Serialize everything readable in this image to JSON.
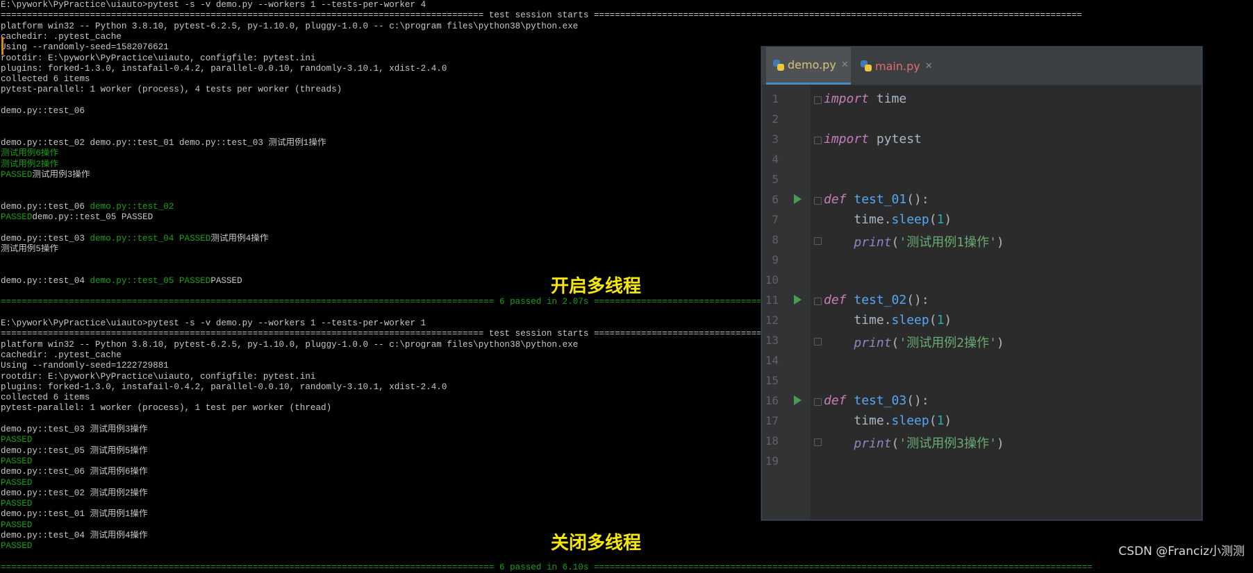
{
  "terminal": {
    "run1": [
      {
        "text": "E:\\pywork\\PyPractice\\uiauto>pytest -s -v demo.py --workers 1 --tests-per-worker 4"
      },
      {
        "text": "============================================================================================ test session starts =============================================================================================",
        "sep": true
      },
      {
        "text": "platform win32 -- Python 3.8.10, pytest-6.2.5, py-1.10.0, pluggy-1.0.0 -- c:\\program files\\python38\\python.exe"
      },
      {
        "text": "cachedir: .pytest_cache"
      },
      {
        "text": "Using --randomly-seed=1582076621"
      },
      {
        "text": "rootdir: E:\\pywork\\PyPractice\\uiauto, configfile: pytest.ini"
      },
      {
        "text": "plugins: forked-1.3.0, instafail-0.4.2, parallel-0.0.10, randomly-3.10.1, xdist-2.4.0"
      },
      {
        "text": "collected 6 items"
      },
      {
        "text": "pytest-parallel: 1 worker (process), 4 tests per worker (threads)"
      },
      {
        "text": ""
      },
      {
        "text": "demo.py::test_06"
      },
      {
        "text": ""
      },
      {
        "text": ""
      },
      {
        "text": "demo.py::test_02 demo.py::test_01 demo.py::test_03 测试用例1操作"
      },
      {
        "text": "测试用例6操作",
        "green": true
      },
      {
        "text": "测试用例2操作",
        "green": true
      },
      {
        "segs": [
          {
            "t": "PASSED",
            "g": true
          },
          {
            "t": "测试用例3操作"
          }
        ]
      },
      {
        "text": ""
      },
      {
        "text": ""
      },
      {
        "segs": [
          {
            "t": "demo.py::test_06 "
          },
          {
            "t": "demo.py::test_02",
            "g": true
          }
        ]
      },
      {
        "segs": [
          {
            "t": "PASSED",
            "g": true
          },
          {
            "t": "demo.py::test_05 PASSED"
          }
        ]
      },
      {
        "text": ""
      },
      {
        "segs": [
          {
            "t": "demo.py::test_03 "
          },
          {
            "t": "demo.py::test_04 PASSED",
            "g": true
          },
          {
            "t": "测试用例4操作"
          }
        ]
      },
      {
        "text": "测试用例5操作"
      },
      {
        "text": ""
      },
      {
        "text": ""
      },
      {
        "segs": [
          {
            "t": "demo.py::test_04 "
          },
          {
            "t": "demo.py::test_05 PASSED",
            "g": true
          },
          {
            "t": "PASSED"
          }
        ]
      },
      {
        "text": ""
      },
      {
        "text": "============================================================================================== 6 passed in 2.07s ===============================================================================================",
        "sep": true,
        "green": true
      }
    ],
    "run2": [
      {
        "text": ""
      },
      {
        "text": "E:\\pywork\\PyPractice\\uiauto>pytest -s -v demo.py --workers 1 --tests-per-worker 1"
      },
      {
        "text": "============================================================================================ test session starts =============================================================================================",
        "sep": true
      },
      {
        "text": "platform win32 -- Python 3.8.10, pytest-6.2.5, py-1.10.0, pluggy-1.0.0 -- c:\\program files\\python38\\python.exe"
      },
      {
        "text": "cachedir: .pytest_cache"
      },
      {
        "text": "Using --randomly-seed=1222729881"
      },
      {
        "text": "rootdir: E:\\pywork\\PyPractice\\uiauto, configfile: pytest.ini"
      },
      {
        "text": "plugins: forked-1.3.0, instafail-0.4.2, parallel-0.0.10, randomly-3.10.1, xdist-2.4.0"
      },
      {
        "text": "collected 6 items"
      },
      {
        "text": "pytest-parallel: 1 worker (process), 1 test per worker (thread)"
      },
      {
        "text": ""
      },
      {
        "text": "demo.py::test_03 测试用例3操作"
      },
      {
        "text": "PASSED",
        "green": true
      },
      {
        "text": "demo.py::test_05 测试用例5操作"
      },
      {
        "text": "PASSED",
        "green": true
      },
      {
        "text": "demo.py::test_06 测试用例6操作"
      },
      {
        "text": "PASSED",
        "green": true
      },
      {
        "text": "demo.py::test_02 测试用例2操作"
      },
      {
        "text": "PASSED",
        "green": true
      },
      {
        "text": "demo.py::test_01 测试用例1操作"
      },
      {
        "text": "PASSED",
        "green": true
      },
      {
        "text": "demo.py::test_04 测试用例4操作"
      },
      {
        "text": "PASSED",
        "green": true
      },
      {
        "text": ""
      },
      {
        "text": "============================================================================================== 6 passed in 6.10s ===============================================================================================",
        "sep": true,
        "green": true
      }
    ]
  },
  "callouts": {
    "top": "开启多线程",
    "bottom": "关闭多线程"
  },
  "editor": {
    "tabs": [
      {
        "name": "demo.py",
        "active": true
      },
      {
        "name": "main.py",
        "active": false
      }
    ],
    "lines": [
      {
        "n": "1",
        "fold": true,
        "tokens": [
          {
            "c": "kwp",
            "t": "import"
          },
          {
            "c": "pl",
            "t": " time"
          }
        ]
      },
      {
        "n": "2",
        "tokens": []
      },
      {
        "n": "3",
        "fold": true,
        "tokens": [
          {
            "c": "kwp",
            "t": "import"
          },
          {
            "c": "pl",
            "t": " pytest"
          }
        ]
      },
      {
        "n": "4",
        "tokens": []
      },
      {
        "n": "5",
        "tokens": []
      },
      {
        "n": "6",
        "run": true,
        "fold": true,
        "tokens": [
          {
            "c": "kwp",
            "t": "def"
          },
          {
            "c": "pl",
            "t": " "
          },
          {
            "c": "fnb",
            "t": "test_01"
          },
          {
            "c": "pl",
            "t": "():"
          }
        ]
      },
      {
        "n": "7",
        "tokens": [
          {
            "c": "pl",
            "t": "    time."
          },
          {
            "c": "mth",
            "t": "sleep"
          },
          {
            "c": "pl",
            "t": "("
          },
          {
            "c": "num",
            "t": "1"
          },
          {
            "c": "pl",
            "t": ")"
          }
        ]
      },
      {
        "n": "8",
        "fold": true,
        "tokens": [
          {
            "c": "pl",
            "t": "    "
          },
          {
            "c": "bi",
            "t": "print"
          },
          {
            "c": "pl",
            "t": "("
          },
          {
            "c": "str",
            "t": "'测试用例1操作'"
          },
          {
            "c": "pl",
            "t": ")"
          }
        ]
      },
      {
        "n": "9",
        "tokens": []
      },
      {
        "n": "10",
        "tokens": []
      },
      {
        "n": "11",
        "run": true,
        "fold": true,
        "tokens": [
          {
            "c": "kwp",
            "t": "def"
          },
          {
            "c": "pl",
            "t": " "
          },
          {
            "c": "fnb",
            "t": "test_02"
          },
          {
            "c": "pl",
            "t": "():"
          }
        ]
      },
      {
        "n": "12",
        "tokens": [
          {
            "c": "pl",
            "t": "    time."
          },
          {
            "c": "mth",
            "t": "sleep"
          },
          {
            "c": "pl",
            "t": "("
          },
          {
            "c": "num",
            "t": "1"
          },
          {
            "c": "pl",
            "t": ")"
          }
        ]
      },
      {
        "n": "13",
        "fold": true,
        "tokens": [
          {
            "c": "pl",
            "t": "    "
          },
          {
            "c": "bi",
            "t": "print"
          },
          {
            "c": "pl",
            "t": "("
          },
          {
            "c": "str",
            "t": "'测试用例2操作'"
          },
          {
            "c": "pl",
            "t": ")"
          }
        ]
      },
      {
        "n": "14",
        "tokens": []
      },
      {
        "n": "15",
        "tokens": []
      },
      {
        "n": "16",
        "run": true,
        "fold": true,
        "tokens": [
          {
            "c": "kwp",
            "t": "def"
          },
          {
            "c": "pl",
            "t": " "
          },
          {
            "c": "fnb",
            "t": "test_03"
          },
          {
            "c": "pl",
            "t": "():"
          }
        ]
      },
      {
        "n": "17",
        "tokens": [
          {
            "c": "pl",
            "t": "    time."
          },
          {
            "c": "mth",
            "t": "sleep"
          },
          {
            "c": "pl",
            "t": "("
          },
          {
            "c": "num",
            "t": "1"
          },
          {
            "c": "pl",
            "t": ")"
          }
        ]
      },
      {
        "n": "18",
        "fold": true,
        "tokens": [
          {
            "c": "pl",
            "t": "    "
          },
          {
            "c": "bi",
            "t": "print"
          },
          {
            "c": "pl",
            "t": "("
          },
          {
            "c": "str",
            "t": "'测试用例3操作'"
          },
          {
            "c": "pl",
            "t": ")"
          }
        ]
      },
      {
        "n": "19",
        "tokens": []
      }
    ]
  },
  "watermark": "CSDN @Franciz小测测",
  "colors": {
    "terminal_green": "#13a10e",
    "callout_yellow": "#f5e70a",
    "editor_bg": "#2b2b2b"
  }
}
